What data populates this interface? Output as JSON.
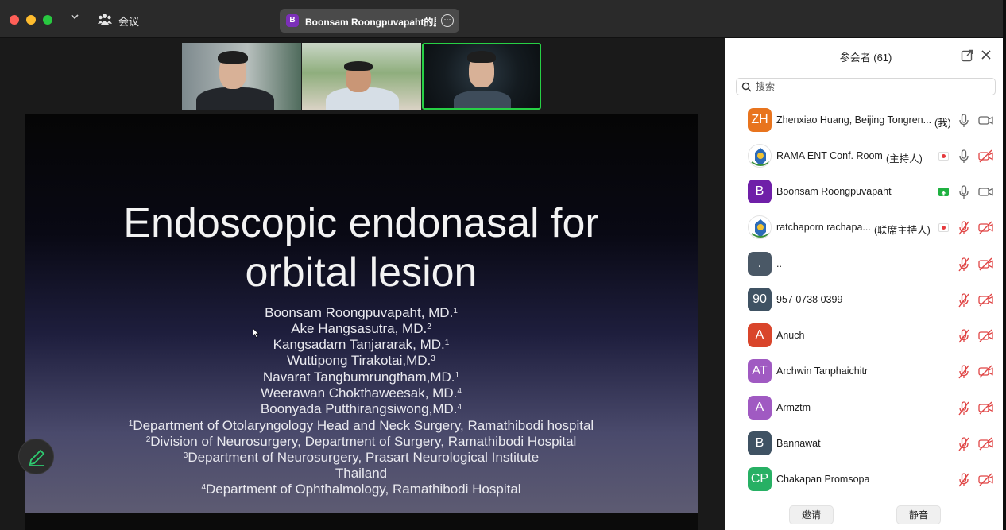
{
  "window": {
    "title": "会议",
    "share_pill": {
      "avatar_letter": "B",
      "name": "Boonsam Roongpuvapaht的屏幕"
    }
  },
  "slide": {
    "title_line1": "Endoscopic endonasal for",
    "title_line2": "orbital lesion",
    "lines": [
      {
        "text": "Boonsam Roongpuvapaht, MD.",
        "sup_before": "",
        "sup_after": "1"
      },
      {
        "text": "Ake Hangsasutra, MD.",
        "sup_before": "",
        "sup_after": "2"
      },
      {
        "text": "Kangsadarn Tanjararak, MD.",
        "sup_before": "",
        "sup_after": "1"
      },
      {
        "text": "Wuttipong Tirakotai,MD.",
        "sup_before": "",
        "sup_after": "3"
      },
      {
        "text": "Navarat Tangbumrungtham,MD.",
        "sup_before": "",
        "sup_after": "1"
      },
      {
        "text": "Weerawan Chokthaweesak, MD.",
        "sup_before": "",
        "sup_after": "4"
      },
      {
        "text": "Boonyada Putthirangsiwong,MD.",
        "sup_before": "",
        "sup_after": "4"
      },
      {
        "text": "Department of Otolaryngology Head and Neck Surgery, Ramathibodi hospital",
        "sup_before": "1",
        "sup_after": ""
      },
      {
        "text": "Division of Neurosurgery, Department of Surgery, Ramathibodi Hospital",
        "sup_before": "2",
        "sup_after": ""
      },
      {
        "text": "Department of Neurosurgery, Prasart Neurological Institute",
        "sup_before": "3",
        "sup_after": ""
      },
      {
        "text": "Thailand",
        "sup_before": "",
        "sup_after": ""
      },
      {
        "text": "Department of Ophthalmology, Ramathibodi Hospital",
        "sup_before": "4",
        "sup_after": ""
      }
    ]
  },
  "panel": {
    "title": "参会者 (61)",
    "search_placeholder": "搜索",
    "participants": [
      {
        "avatar": "ZH",
        "color": "#e8741e",
        "name": "Zhenxiao Huang, Beijing Tongren...",
        "role": "(我)",
        "badge": "",
        "mic": "on",
        "cam": "on"
      },
      {
        "avatar": "",
        "color": "logo",
        "name": "RAMA ENT Conf. Room",
        "role": "(主持人)",
        "badge": "rec",
        "mic": "on",
        "cam": "off"
      },
      {
        "avatar": "B",
        "color": "#6f1fa8",
        "name": "Boonsam Roongpuvapaht",
        "role": "",
        "badge": "share",
        "mic": "on",
        "cam": "on"
      },
      {
        "avatar": "",
        "color": "logo",
        "name": "ratchaporn rachapa...",
        "role": "(联席主持人)",
        "badge": "rec",
        "mic": "off",
        "cam": "off"
      },
      {
        "avatar": ".",
        "color": "#4a5866",
        "name": "..",
        "role": "",
        "badge": "",
        "mic": "off",
        "cam": "off"
      },
      {
        "avatar": "90",
        "color": "#3f5263",
        "name": "957 0738 0399",
        "role": "",
        "badge": "",
        "mic": "off",
        "cam": "off"
      },
      {
        "avatar": "A",
        "color": "#d9452b",
        "name": "Anuch",
        "role": "",
        "badge": "",
        "mic": "off",
        "cam": "off"
      },
      {
        "avatar": "AT",
        "color": "#a05ac2",
        "name": "Archwin Tanphaichitr",
        "role": "",
        "badge": "",
        "mic": "off",
        "cam": "off"
      },
      {
        "avatar": "A",
        "color": "#a05ac2",
        "name": "Armztm",
        "role": "",
        "badge": "",
        "mic": "off",
        "cam": "off"
      },
      {
        "avatar": "B",
        "color": "#3f5263",
        "name": "Bannawat",
        "role": "",
        "badge": "",
        "mic": "off",
        "cam": "off"
      },
      {
        "avatar": "CP",
        "color": "#27b064",
        "name": "Chakapan Promsopa",
        "role": "",
        "badge": "",
        "mic": "off",
        "cam": "off"
      }
    ],
    "invite_label": "邀请",
    "mute_label": "静音"
  }
}
